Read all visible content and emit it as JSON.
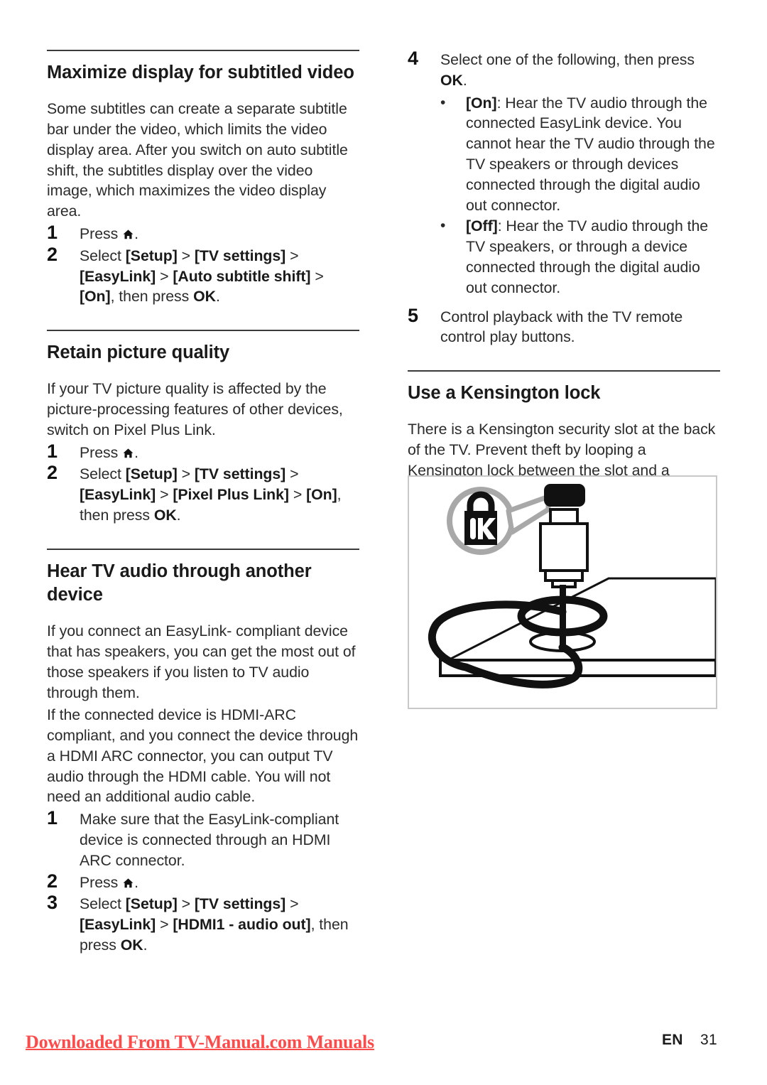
{
  "document": {
    "left_column": {
      "sections": [
        {
          "id": "maximize-display",
          "title": "Maximize display for subtitled video",
          "paragraphs": [
            "Some subtitles can create a separate subtitle bar under the video, which limits the video display area. After you switch on auto subtitle shift, the subtitles display over the video image, which maximizes the video display area."
          ],
          "steps": [
            {
              "num": "1",
              "pre": "Press ",
              "icon": "home-icon",
              "post": "."
            },
            {
              "num": "2",
              "text_parts": [
                {
                  "t": "Select ",
                  "b": false
                },
                {
                  "t": "[Setup]",
                  "b": true
                },
                {
                  "t": " > ",
                  "b": false
                },
                {
                  "t": "[TV settings]",
                  "b": true
                },
                {
                  "t": " > ",
                  "b": false
                },
                {
                  "t": "[EasyLink]",
                  "b": true
                },
                {
                  "t": " > ",
                  "b": false
                },
                {
                  "t": "[Auto subtitle shift]",
                  "b": true
                },
                {
                  "t": " > ",
                  "b": false
                },
                {
                  "t": "[On]",
                  "b": true
                },
                {
                  "t": ", then press ",
                  "b": false
                },
                {
                  "t": "OK",
                  "b": true
                },
                {
                  "t": ".",
                  "b": false
                }
              ]
            }
          ]
        },
        {
          "id": "retain-picture-quality",
          "title": "Retain picture quality",
          "paragraphs": [
            "If your TV picture quality is affected by the picture-processing features of other devices, switch on Pixel Plus Link."
          ],
          "steps": [
            {
              "num": "1",
              "pre": "Press ",
              "icon": "home-icon",
              "post": "."
            },
            {
              "num": "2",
              "text_parts": [
                {
                  "t": "Select ",
                  "b": false
                },
                {
                  "t": "[Setup]",
                  "b": true
                },
                {
                  "t": " > ",
                  "b": false
                },
                {
                  "t": "[TV settings]",
                  "b": true
                },
                {
                  "t": " > ",
                  "b": false
                },
                {
                  "t": "[EasyLink]",
                  "b": true
                },
                {
                  "t": " > ",
                  "b": false
                },
                {
                  "t": "[Pixel Plus Link]",
                  "b": true
                },
                {
                  "t": " > ",
                  "b": false
                },
                {
                  "t": "[On]",
                  "b": true
                },
                {
                  "t": ", then press ",
                  "b": false
                },
                {
                  "t": "OK",
                  "b": true
                },
                {
                  "t": ".",
                  "b": false
                }
              ]
            }
          ]
        },
        {
          "id": "hear-tv-audio",
          "title": "Hear TV audio through another device",
          "paragraphs": [
            "If you connect an EasyLink- compliant device that has speakers, you can get the most out of those speakers if you listen to TV audio through them.",
            "If the connected device is HDMI-ARC compliant, and you connect the device through a HDMI ARC connector, you can output TV audio through the HDMI cable. You will not need an additional audio cable."
          ],
          "steps": [
            {
              "num": "1",
              "text_parts": [
                {
                  "t": "Make sure that the EasyLink-compliant device is connected through an HDMI ARC connector.",
                  "b": false
                }
              ]
            },
            {
              "num": "2",
              "pre": "Press ",
              "icon": "home-icon",
              "post": "."
            },
            {
              "num": "3",
              "text_parts": [
                {
                  "t": "Select ",
                  "b": false
                },
                {
                  "t": "[Setup]",
                  "b": true
                },
                {
                  "t": " > ",
                  "b": false
                },
                {
                  "t": "[TV settings]",
                  "b": true
                },
                {
                  "t": " > ",
                  "b": false
                },
                {
                  "t": "[EasyLink]",
                  "b": true
                },
                {
                  "t": " > ",
                  "b": false
                },
                {
                  "t": "[HDMI1 - audio out]",
                  "b": true
                },
                {
                  "t": ", then press ",
                  "b": false
                },
                {
                  "t": "OK",
                  "b": true
                },
                {
                  "t": ".",
                  "b": false
                }
              ]
            }
          ]
        }
      ]
    },
    "right_column": {
      "continued_steps": [
        {
          "num": "4",
          "text_parts": [
            {
              "t": "Select one of the following, then press ",
              "b": false
            },
            {
              "t": "OK",
              "b": true
            },
            {
              "t": ".",
              "b": false
            }
          ]
        }
      ],
      "bullets": [
        {
          "label": "[On]",
          "text": ": Hear the TV audio through the connected EasyLink device. You cannot hear the TV audio through the TV speakers or through devices connected through the digital audio out connector."
        },
        {
          "label": "[Off]",
          "text": ": Hear the TV audio through the TV speakers, or through a device connected through the digital audio out connector."
        }
      ],
      "final_step": {
        "num": "5",
        "text": "Control playback with the TV remote control play buttons."
      },
      "kensington": {
        "title": "Use a Kensington lock",
        "paragraph": "There is a Kensington security slot at the back of the TV. Prevent theft by looping a Kensington lock between the slot and a permanent object, such as a heavy table."
      },
      "figure": {
        "name": "kensington-lock-illustration",
        "alt": "Kensington lock cable looped through a table with a callout showing the Kensington padlock logo"
      }
    },
    "footer": {
      "watermark": "Downloaded From TV-Manual.com Manuals",
      "language": "EN",
      "page_number": "31"
    },
    "colors": {
      "text": "#2b2b2b",
      "heading": "#1a1a1a",
      "rule": "#3a3a3a",
      "watermark": "#fb4b4b",
      "figure_border": "#c8c8c8",
      "figure_callout": "#a8a8a8"
    }
  }
}
